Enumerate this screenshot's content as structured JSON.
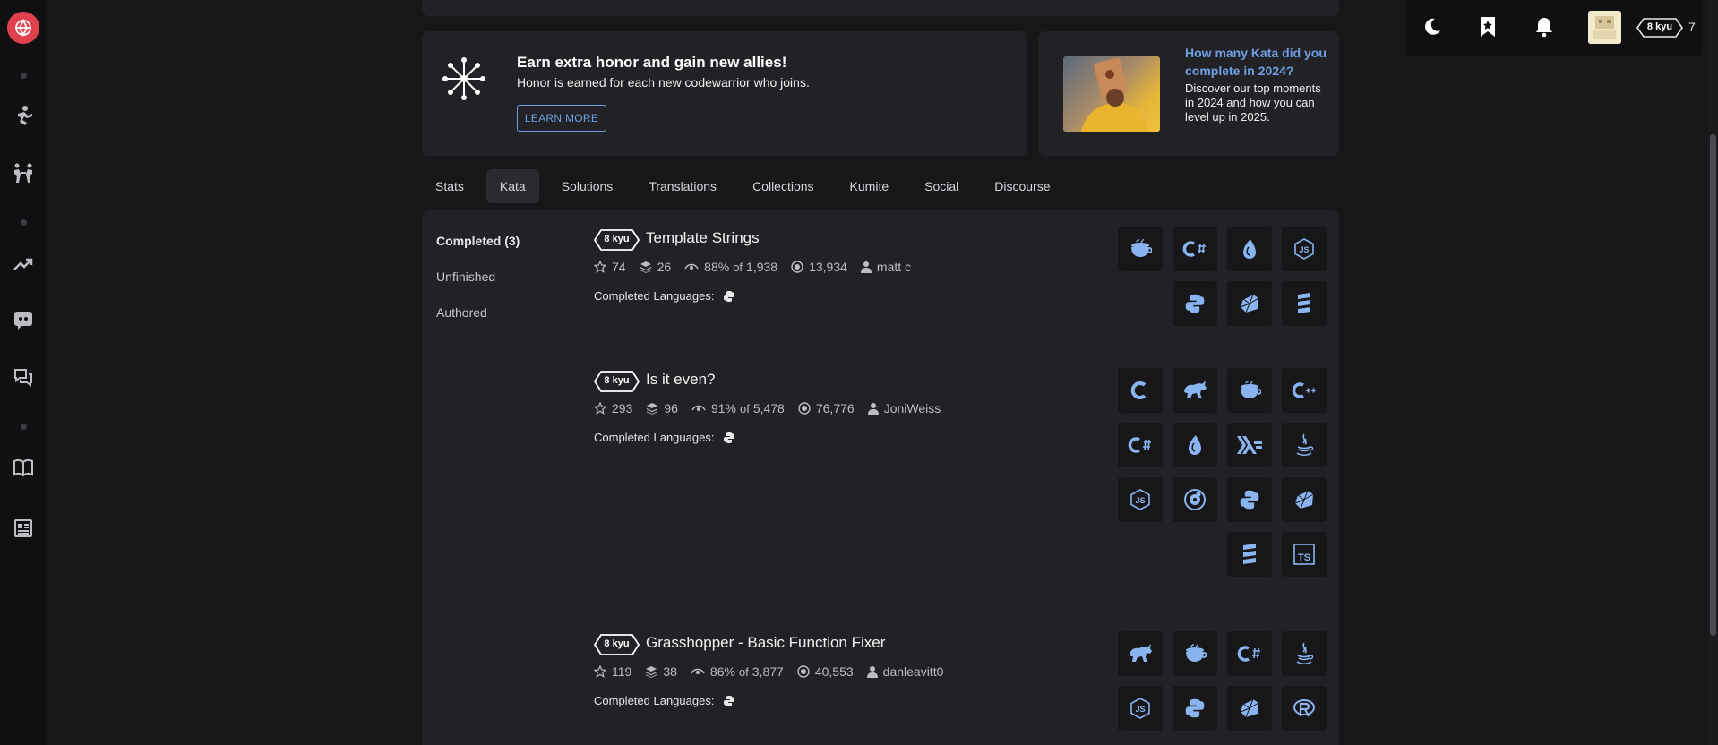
{
  "top_nav": {
    "rank": "8 kyu",
    "honor": "7"
  },
  "banners": {
    "honor": {
      "title": "Earn extra honor and gain new allies!",
      "subtitle": "Honor is earned for each new codewarrior who joins.",
      "button": "LEARN MORE"
    },
    "year_review": {
      "title": "How many Kata did you complete in 2024?",
      "subtitle": "Discover our top moments in 2024 and how you can level up in 2025."
    }
  },
  "tabs": [
    "Stats",
    "Kata",
    "Solutions",
    "Translations",
    "Collections",
    "Kumite",
    "Social",
    "Discourse"
  ],
  "active_tab": "Kata",
  "subnav": [
    "Completed (3)",
    "Unfinished",
    "Authored"
  ],
  "completed_languages_label": "Completed Languages:",
  "katas": [
    {
      "rank": "8 kyu",
      "title": "Template Strings",
      "stars": "74",
      "collections": "26",
      "satisfaction": "88%",
      "of": "of",
      "votes": "1,938",
      "completions": "13,934",
      "author": "matt c",
      "languages": [
        "coffeescript-icon",
        "csharp-icon",
        "elixir-icon",
        "javascript-icon",
        "python-icon",
        "ruby-icon",
        "scala-icon"
      ]
    },
    {
      "rank": "8 kyu",
      "title": "Is it even?",
      "stars": "293",
      "collections": "96",
      "satisfaction": "91%",
      "of": "of",
      "votes": "5,478",
      "completions": "76,776",
      "author": "JoniWeiss",
      "languages": [
        "c-icon",
        "clojure-icon",
        "coffeescript-icon",
        "cpp-icon",
        "csharp-icon",
        "elixir-icon",
        "haskell-icon",
        "java-icon",
        "javascript-icon",
        "julia-icon",
        "python-icon",
        "ruby-icon",
        "scala-icon",
        "typescript-icon"
      ]
    },
    {
      "rank": "8 kyu",
      "title": "Grasshopper - Basic Function Fixer",
      "stars": "119",
      "collections": "38",
      "satisfaction": "86%",
      "of": "of",
      "votes": "3,877",
      "completions": "40,553",
      "author": "danleavitt0",
      "languages": [
        "clojure-icon",
        "coffeescript-icon",
        "csharp-icon",
        "java-icon",
        "javascript-icon",
        "python-icon",
        "ruby-icon",
        "r-icon"
      ]
    }
  ],
  "colors": {
    "brand": "#e1414d",
    "accent": "#6e9fe4",
    "language_icon": "#89b4f0",
    "background": "#17171a",
    "card": "#222226"
  }
}
